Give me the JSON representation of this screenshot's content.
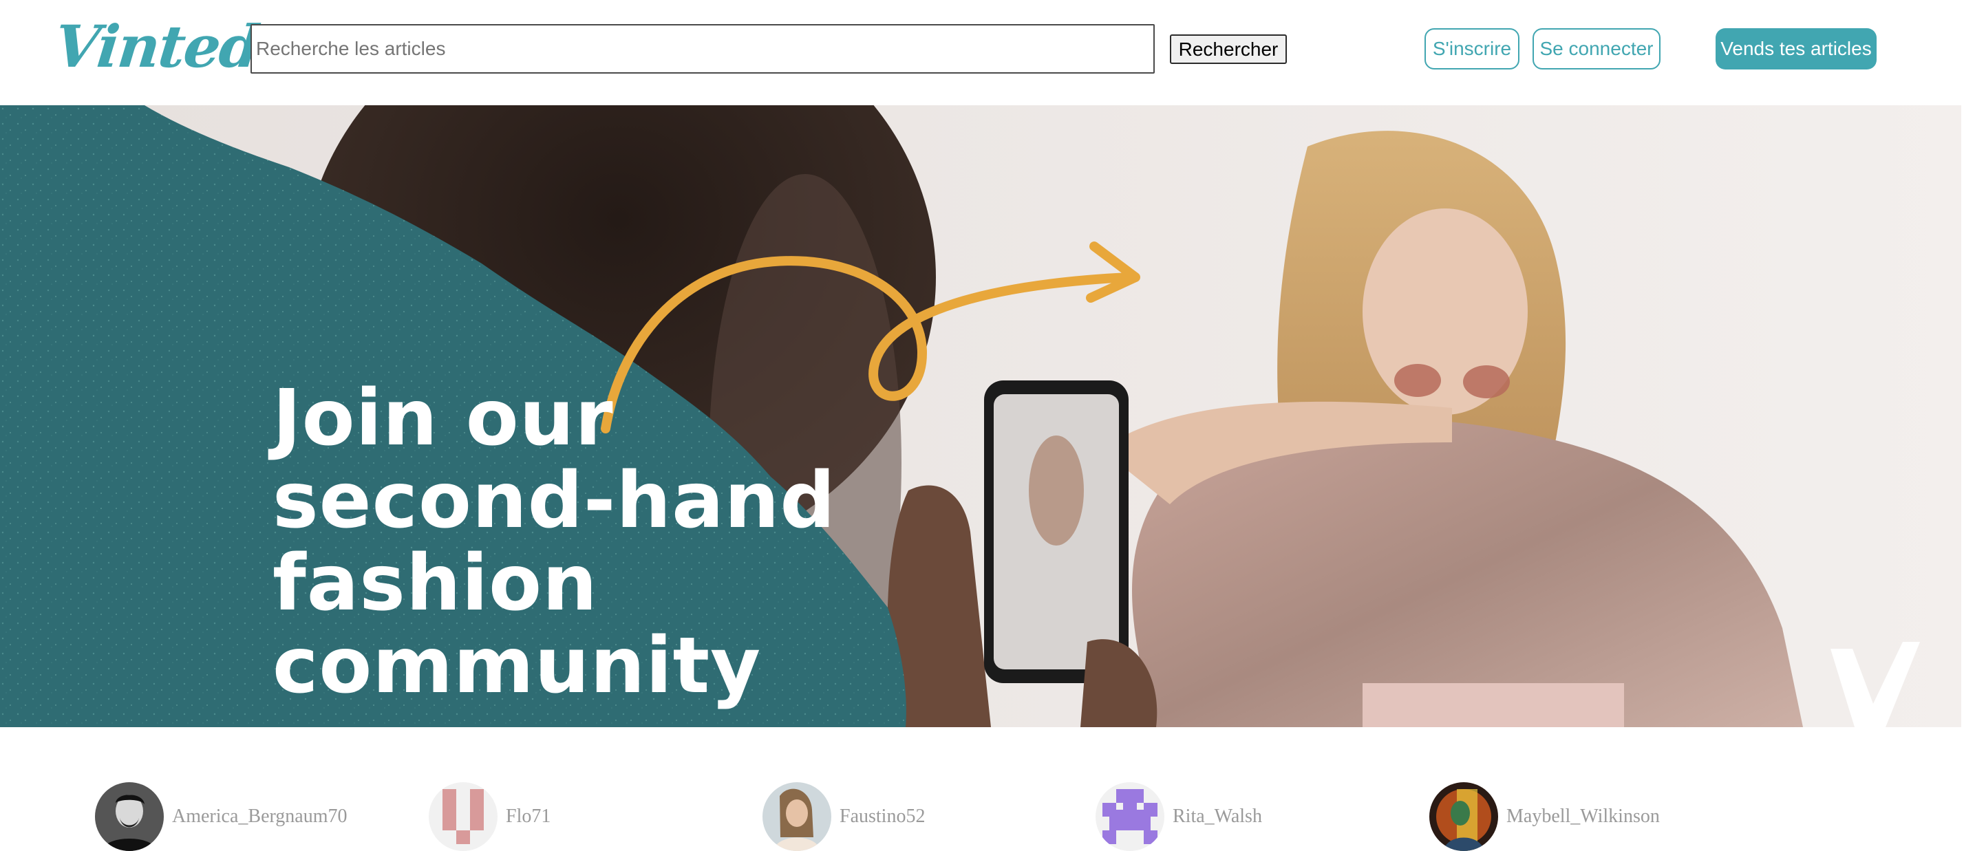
{
  "header": {
    "logo_text": "Vinted",
    "search_placeholder": "Recherche les articles",
    "search_button": "Rechercher",
    "signup_button": "S'inscrire",
    "login_button": "Se connecter",
    "sell_button": "Vends tes articles"
  },
  "hero": {
    "headline_lines": [
      "Join our",
      "second-hand",
      "fashion",
      "community"
    ],
    "colors": {
      "teal": "#2f6c73",
      "arrow": "#e8a73b"
    }
  },
  "members": [
    {
      "username": "America_Bergnaum70",
      "avatar": "photo-man"
    },
    {
      "username": "Flo71",
      "avatar": "pixel-pink"
    },
    {
      "username": "Faustino52",
      "avatar": "photo-woman"
    },
    {
      "username": "Rita_Walsh",
      "avatar": "pixel-purple"
    },
    {
      "username": "Maybell_Wilkinson",
      "avatar": "photo-colorful"
    }
  ],
  "colors": {
    "brand": "#41a6b1",
    "member_name": "#9a9a9a"
  }
}
